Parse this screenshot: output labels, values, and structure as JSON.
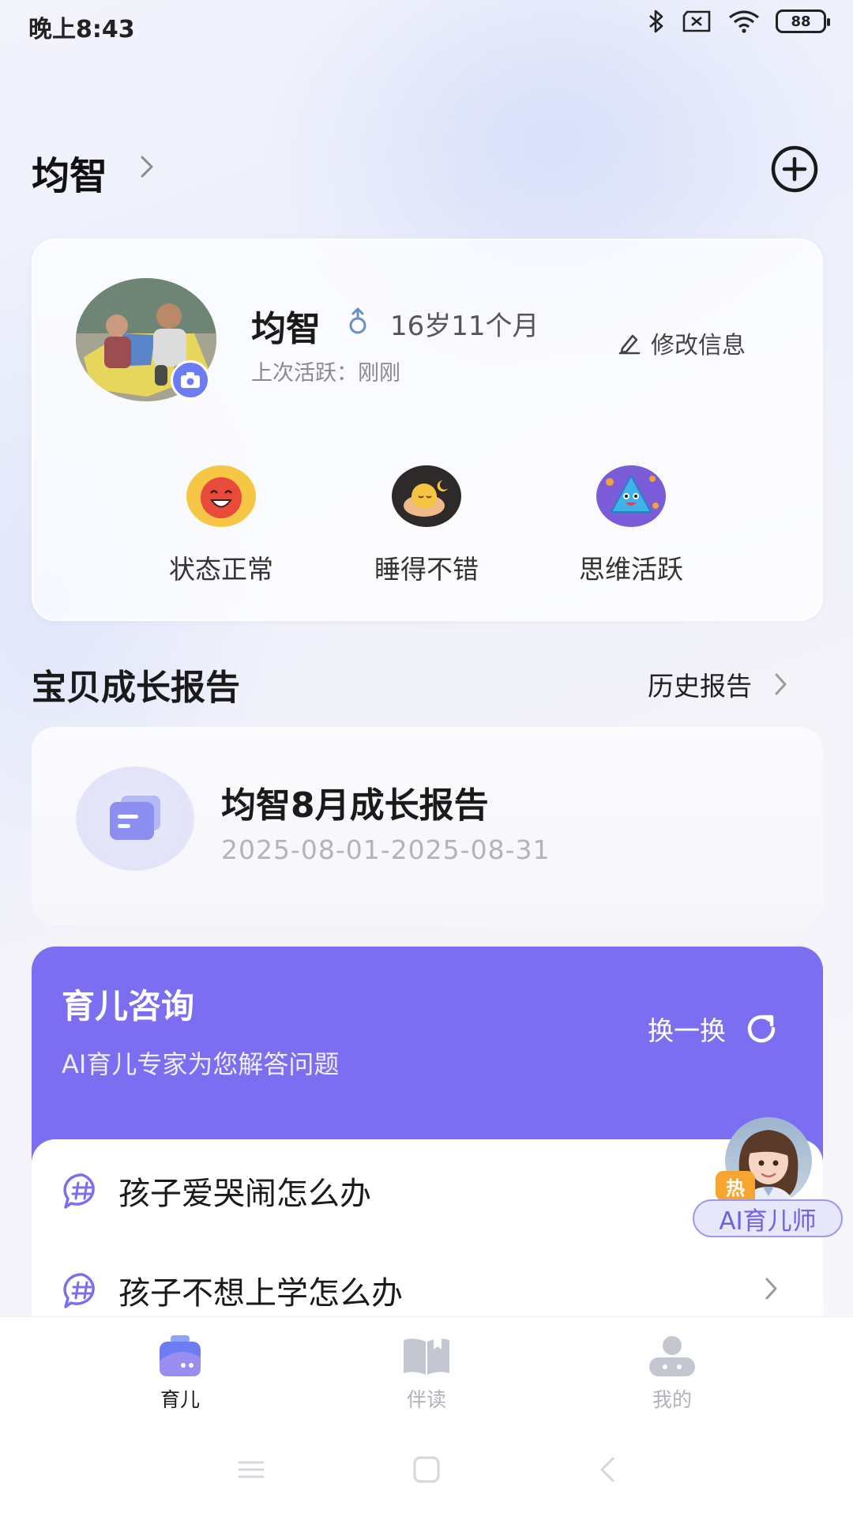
{
  "status_bar": {
    "time": "晚上8:43",
    "battery": "88"
  },
  "header": {
    "child_name": "均智"
  },
  "profile": {
    "name": "均智",
    "age": "16岁11个月",
    "last_active": "上次活跃：刚刚",
    "edit_label": "修改信息",
    "moods": [
      {
        "label": "状态正常",
        "icon": "laughing-face-icon"
      },
      {
        "label": "睡得不错",
        "icon": "sleeping-face-icon"
      },
      {
        "label": "思维活跃",
        "icon": "triangle-monster-icon"
      }
    ]
  },
  "report_section": {
    "title": "宝贝成长报告",
    "history_label": "历史报告",
    "report_title": "均智8月成长报告",
    "report_range": "2025-08-01-2025-08-31"
  },
  "consult": {
    "title": "育儿咨询",
    "subtitle": "AI育儿专家为您解答问题",
    "refresh_label": "换一换",
    "questions": [
      "孩子爱哭闹怎么办",
      "孩子不想上学怎么办"
    ]
  },
  "ai_assistant": {
    "badge": "热",
    "label": "AI育儿师"
  },
  "bottom_nav": {
    "items": [
      {
        "label": "育儿",
        "icon": "baby-bag-icon",
        "active": true
      },
      {
        "label": "伴读",
        "icon": "book-icon",
        "active": false
      },
      {
        "label": "我的",
        "icon": "user-icon",
        "active": false
      }
    ]
  },
  "colors": {
    "accent": "#7b6ef0",
    "hot": "#f7a531",
    "nav_active": "#6c7df3",
    "nav_inactive": "#c4c6d0"
  }
}
